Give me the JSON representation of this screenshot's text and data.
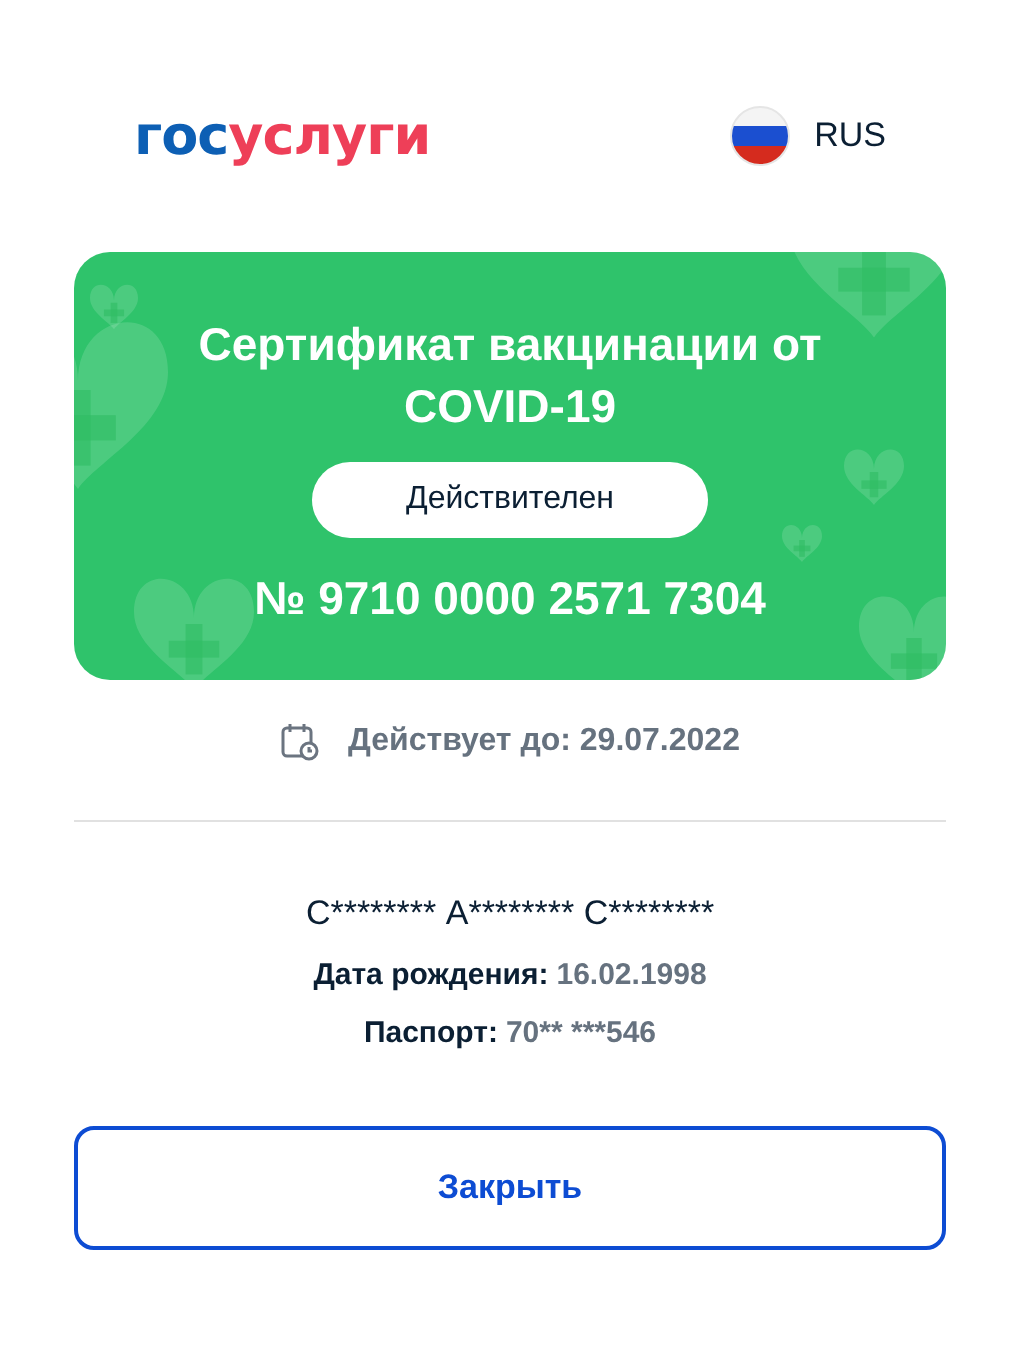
{
  "logo": {
    "part_1": "гос",
    "part_2": "услуги"
  },
  "language": {
    "label": "RUS"
  },
  "certificate": {
    "title": "Сертификат вакцинации от COVID-19",
    "status": "Действителен",
    "number": "№ 9710 0000 2571 7304"
  },
  "validity": {
    "label": "Действует до: 29.07.2022"
  },
  "person": {
    "name": "С******** А******** С********",
    "fields": [
      {
        "label": "Дата рождения:",
        "value": "16.02.1998"
      },
      {
        "label": "Паспорт:",
        "value": "70** ***546"
      }
    ]
  },
  "buttons": [
    "Закрыть"
  ]
}
